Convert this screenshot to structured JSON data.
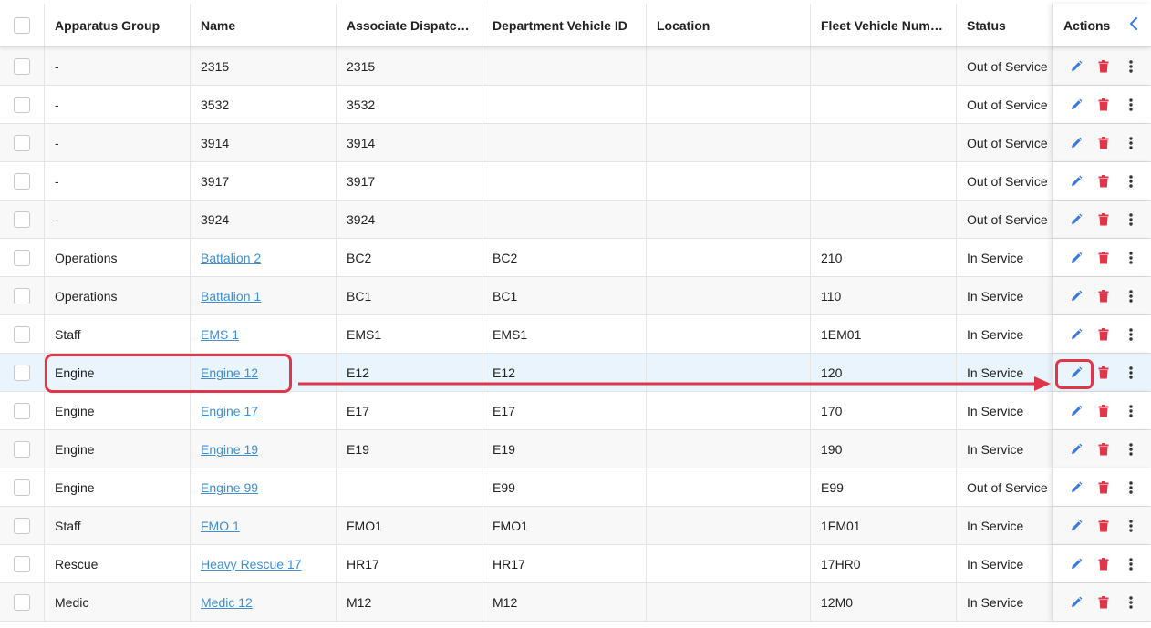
{
  "table": {
    "columns": [
      "Apparatus Group",
      "Name",
      "Associate Dispatc…",
      "Department Vehicle ID",
      "Location",
      "Fleet Vehicle Num…",
      "Status",
      "Actions"
    ],
    "rows": [
      {
        "group": "-",
        "name": "2315",
        "dispatch": "2315",
        "dept_id": "",
        "location": "",
        "fleet": "",
        "status": "Out of Service"
      },
      {
        "group": "-",
        "name": "3532",
        "dispatch": "3532",
        "dept_id": "",
        "location": "",
        "fleet": "",
        "status": "Out of Service"
      },
      {
        "group": "-",
        "name": "3914",
        "dispatch": "3914",
        "dept_id": "",
        "location": "",
        "fleet": "",
        "status": "Out of Service"
      },
      {
        "group": "-",
        "name": "3917",
        "dispatch": "3917",
        "dept_id": "",
        "location": "",
        "fleet": "",
        "status": "Out of Service"
      },
      {
        "group": "-",
        "name": "3924",
        "dispatch": "3924",
        "dept_id": "",
        "location": "",
        "fleet": "",
        "status": "Out of Service"
      },
      {
        "group": "Operations",
        "name": "Battalion 2",
        "dispatch": "BC2",
        "dept_id": "BC2",
        "location": "",
        "fleet": "210",
        "status": "In Service"
      },
      {
        "group": "Operations",
        "name": "Battalion 1",
        "dispatch": "BC1",
        "dept_id": "BC1",
        "location": "",
        "fleet": "110",
        "status": "In Service"
      },
      {
        "group": "Staff",
        "name": "EMS 1",
        "dispatch": "EMS1",
        "dept_id": "EMS1",
        "location": "",
        "fleet": "1EM01",
        "status": "In Service"
      },
      {
        "group": "Engine",
        "name": "Engine 12",
        "dispatch": "E12",
        "dept_id": "E12",
        "location": "",
        "fleet": "120",
        "status": "In Service"
      },
      {
        "group": "Engine",
        "name": "Engine 17",
        "dispatch": "E17",
        "dept_id": "E17",
        "location": "",
        "fleet": "170",
        "status": "In Service"
      },
      {
        "group": "Engine",
        "name": "Engine 19",
        "dispatch": "E19",
        "dept_id": "E19",
        "location": "",
        "fleet": "190",
        "status": "In Service"
      },
      {
        "group": "Engine",
        "name": "Engine 99",
        "dispatch": "",
        "dept_id": "E99",
        "location": "",
        "fleet": "E99",
        "status": "Out of Service"
      },
      {
        "group": "Staff",
        "name": "FMO 1",
        "dispatch": "FMO1",
        "dept_id": "FMO1",
        "location": "",
        "fleet": "1FM01",
        "status": "In Service"
      },
      {
        "group": "Rescue",
        "name": "Heavy Rescue 17",
        "dispatch": "HR17",
        "dept_id": "HR17",
        "location": "",
        "fleet": "17HR0",
        "status": "In Service"
      },
      {
        "group": "Medic",
        "name": "Medic 12",
        "dispatch": "M12",
        "dept_id": "M12",
        "location": "",
        "fleet": "12M0",
        "status": "In Service"
      }
    ]
  },
  "icons": {
    "edit": "pencil-icon",
    "delete": "trash-icon",
    "more": "more-vertical-icon",
    "collapse": "chevron-left-icon"
  },
  "colors": {
    "edit": "#3a78e0",
    "delete": "#e0364a",
    "link": "#3f8fd2",
    "highlight_row": "#e9f4fc",
    "annotation": "#e0364a"
  }
}
